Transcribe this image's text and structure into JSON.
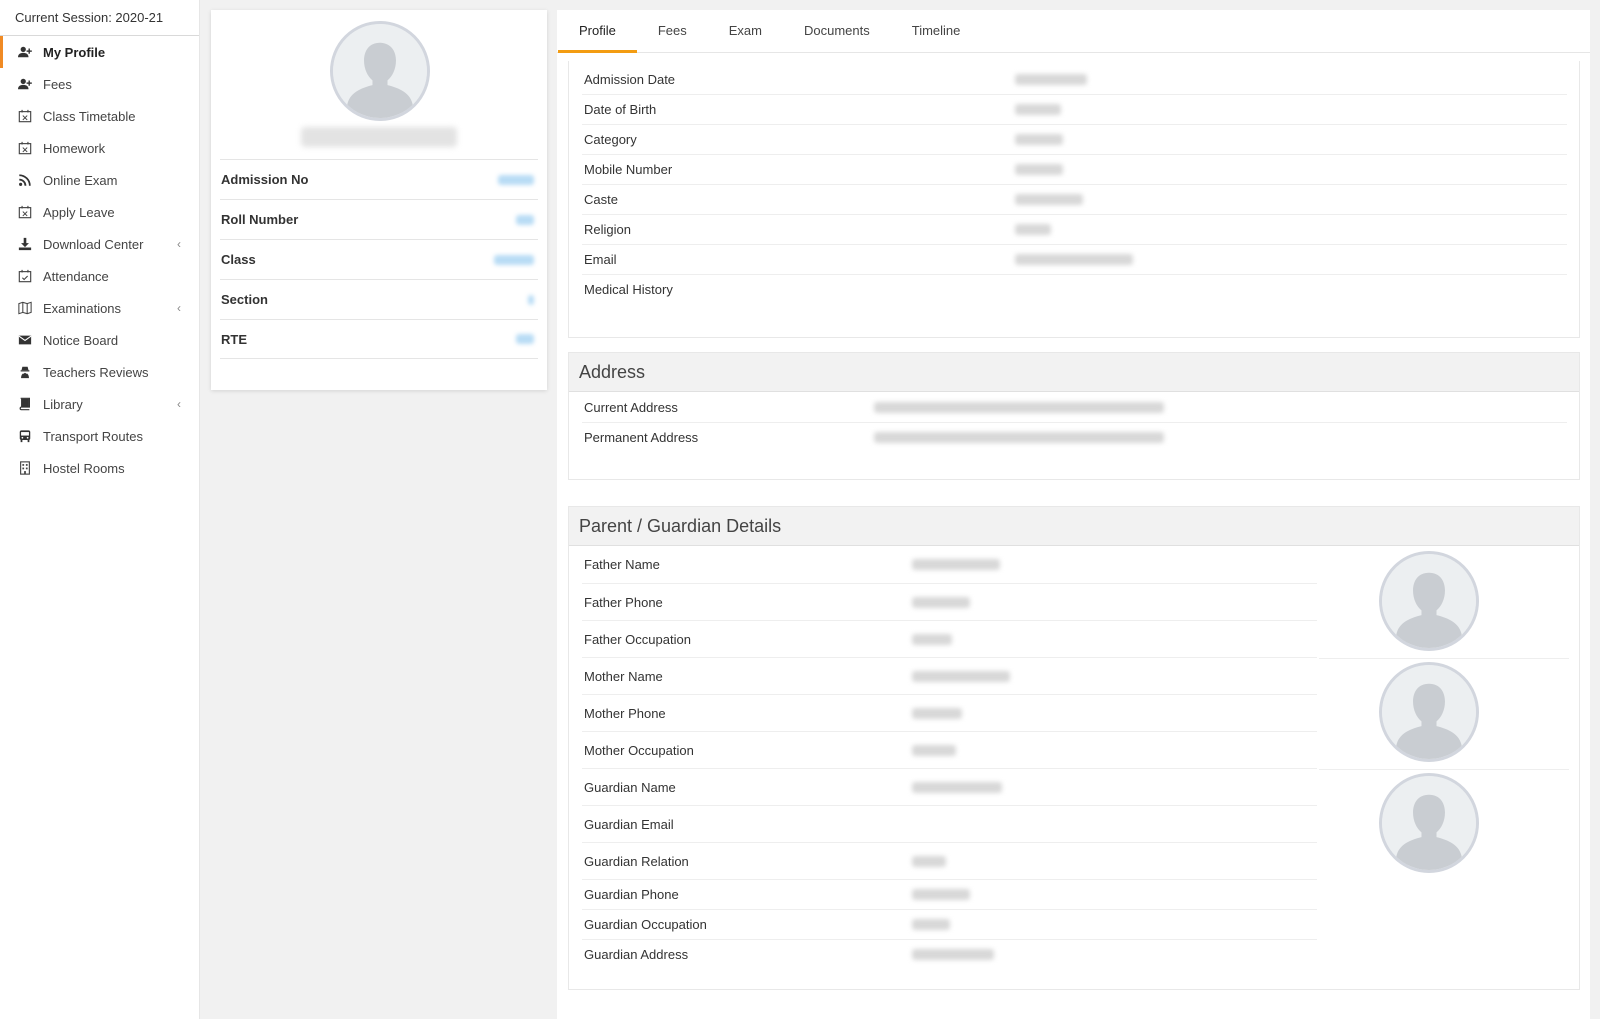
{
  "sidebar": {
    "session": "Current Session: 2020-21",
    "items": [
      {
        "label": "My Profile",
        "icon": "user-plus-icon",
        "active": true
      },
      {
        "label": "Fees",
        "icon": "user-plus-icon"
      },
      {
        "label": "Class Timetable",
        "icon": "calendar-x-icon"
      },
      {
        "label": "Homework",
        "icon": "calendar-x-icon"
      },
      {
        "label": "Online Exam",
        "icon": "rss-icon"
      },
      {
        "label": "Apply Leave",
        "icon": "calendar-x-icon"
      },
      {
        "label": "Download Center",
        "icon": "download-icon",
        "caret": "‹"
      },
      {
        "label": "Attendance",
        "icon": "calendar-check-icon"
      },
      {
        "label": "Examinations",
        "icon": "map-icon",
        "caret": "‹"
      },
      {
        "label": "Notice Board",
        "icon": "envelope-icon"
      },
      {
        "label": "Teachers Reviews",
        "icon": "user-secret-icon"
      },
      {
        "label": "Library",
        "icon": "book-icon",
        "caret": "‹"
      },
      {
        "label": "Transport Routes",
        "icon": "bus-icon"
      },
      {
        "label": "Hostel Rooms",
        "icon": "building-icon"
      }
    ]
  },
  "profile": {
    "fields": [
      {
        "label": "Admission No"
      },
      {
        "label": "Roll Number"
      },
      {
        "label": "Class"
      },
      {
        "label": "Section"
      },
      {
        "label": "RTE"
      }
    ]
  },
  "tabs": [
    "Profile",
    "Fees",
    "Exam",
    "Documents",
    "Timeline"
  ],
  "details": {
    "rows": [
      "Admission Date",
      "Date of Birth",
      "Category",
      "Mobile Number",
      "Caste",
      "Religion",
      "Email",
      "Medical History"
    ]
  },
  "address": {
    "title": "Address",
    "rows": [
      "Current Address",
      "Permanent Address"
    ]
  },
  "parent": {
    "title": "Parent / Guardian Details",
    "rows": [
      "Father Name",
      "Father Phone",
      "Father Occupation",
      "Mother Name",
      "Mother Phone",
      "Mother Occupation",
      "Guardian Name",
      "Guardian Email",
      "Guardian Relation",
      "Guardian Phone",
      "Guardian Occupation",
      "Guardian Address"
    ]
  },
  "colors": {
    "accent": "#f39c12",
    "sidebar_active": "#f08a24",
    "link_blur": "#b8dcf5"
  }
}
